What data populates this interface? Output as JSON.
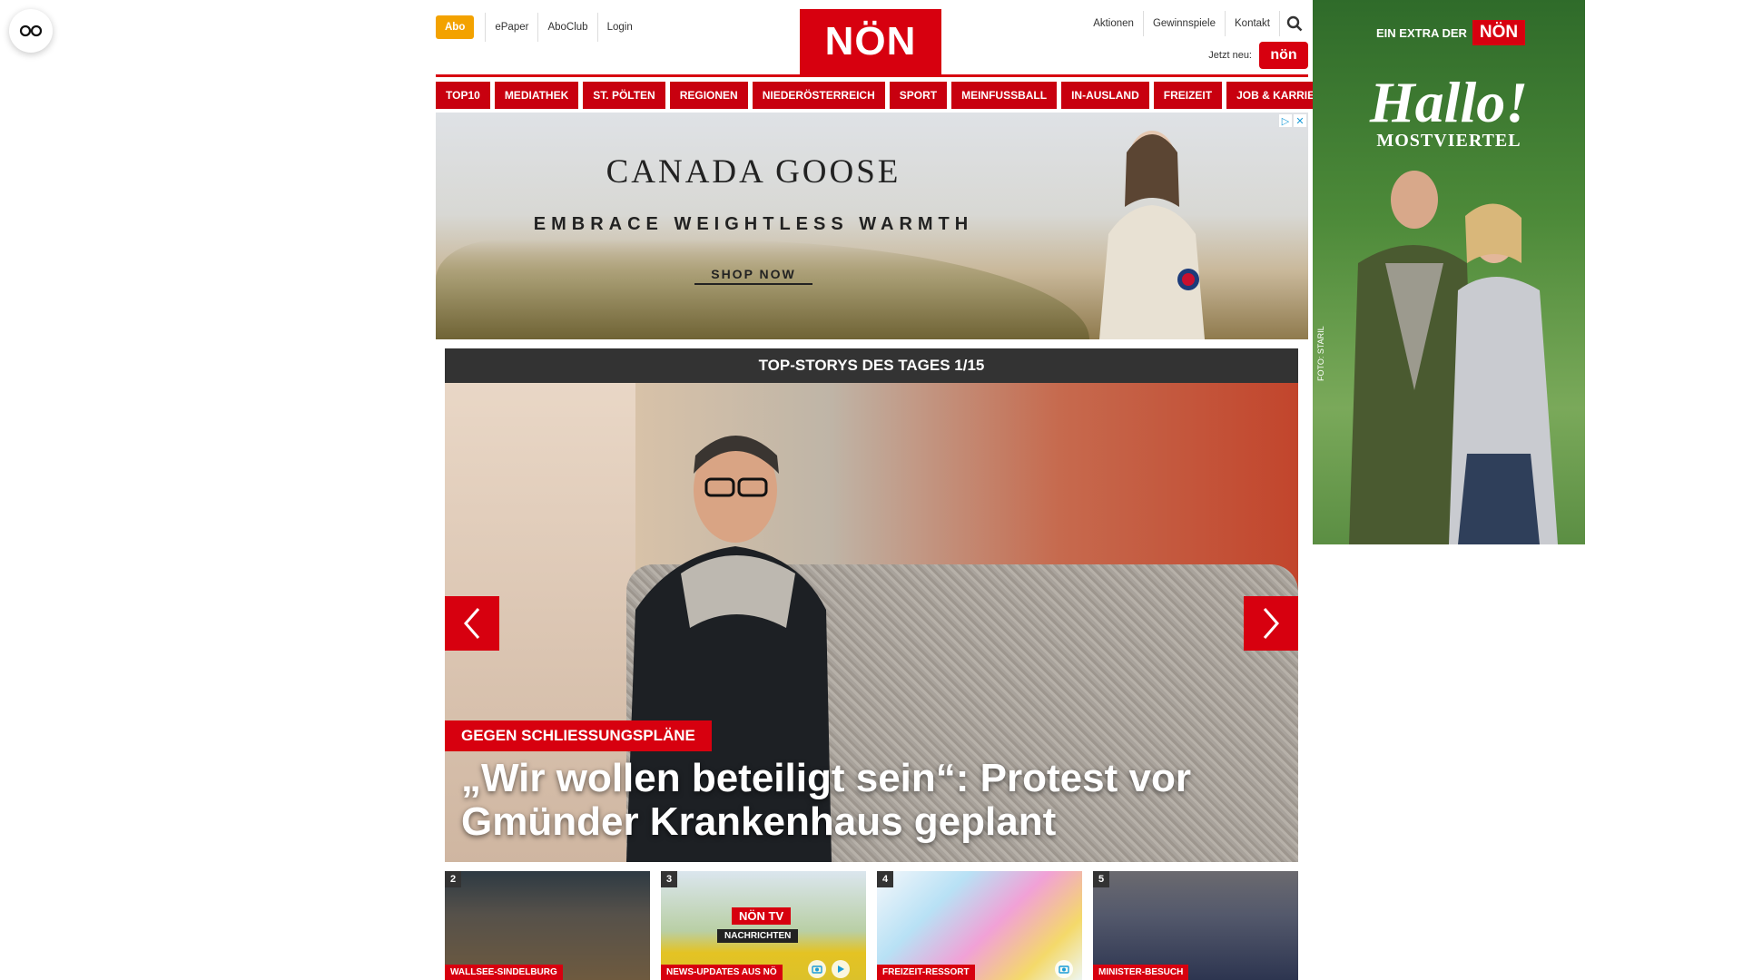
{
  "header": {
    "abo": "Abo",
    "left_links": [
      "ePaper",
      "AboClub",
      "Login"
    ],
    "logo": "NÖN",
    "right_links": [
      "Aktionen",
      "Gewinnspiele",
      "Kontakt"
    ],
    "jetzt_neu": "Jetzt neu:",
    "jetzt_badge": "nön"
  },
  "nav": {
    "items": [
      "TOP10",
      "MEDIATHEK",
      "ST. PÖLTEN",
      "REGIONEN",
      "NIEDERÖSTERREICH",
      "SPORT",
      "MEINFUSSBALL",
      "IN-AUSLAND",
      "FREIZEIT",
      "JOB & KARRIERE"
    ]
  },
  "ad_banner": {
    "brand": "CANADA GOOSE",
    "tagline": "EMBRACE WEIGHTLESS WARMTH",
    "cta": "SHOP NOW"
  },
  "sky_ad": {
    "extra": "EIN EXTRA DER",
    "extra_logo": "NÖN",
    "headline": "Hallo!",
    "subline": "MOSTVIERTEL",
    "credit": "FOTO: STARIL"
  },
  "stories": {
    "heading": "TOP-STORYS DES TAGES 1/15",
    "main": {
      "kicker": "GEGEN SCHLIESSUNGSPLÄNE",
      "title": "„Wir wollen beteiligt sein“: Protest vor Gmünder Krankenhaus geplant"
    },
    "thumbs": [
      {
        "num": "2",
        "label": "WALLSEE-SINDELBURG"
      },
      {
        "num": "3",
        "label": "NEWS-UPDATES AUS NÖ",
        "overlay1": "NÖN TV",
        "overlay2": "NACHRICHTEN"
      },
      {
        "num": "4",
        "label": "FREIZEIT-RESSORT"
      },
      {
        "num": "5",
        "label": "MINISTER-BESUCH"
      }
    ]
  },
  "colors": {
    "brand_red": "#d7000f",
    "abo_orange": "#f3a200",
    "dark_bar": "#333333"
  }
}
